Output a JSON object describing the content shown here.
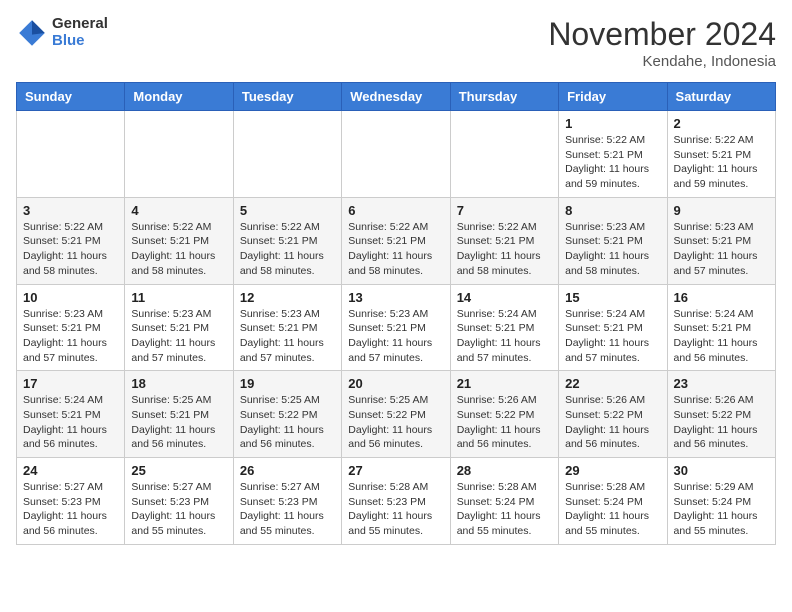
{
  "logo": {
    "general": "General",
    "blue": "Blue"
  },
  "header": {
    "month": "November 2024",
    "location": "Kendahe, Indonesia"
  },
  "weekdays": [
    "Sunday",
    "Monday",
    "Tuesday",
    "Wednesday",
    "Thursday",
    "Friday",
    "Saturday"
  ],
  "weeks": [
    [
      {
        "day": "",
        "sunrise": "",
        "sunset": "",
        "daylight": ""
      },
      {
        "day": "",
        "sunrise": "",
        "sunset": "",
        "daylight": ""
      },
      {
        "day": "",
        "sunrise": "",
        "sunset": "",
        "daylight": ""
      },
      {
        "day": "",
        "sunrise": "",
        "sunset": "",
        "daylight": ""
      },
      {
        "day": "",
        "sunrise": "",
        "sunset": "",
        "daylight": ""
      },
      {
        "day": "1",
        "sunrise": "Sunrise: 5:22 AM",
        "sunset": "Sunset: 5:21 PM",
        "daylight": "Daylight: 11 hours and 59 minutes."
      },
      {
        "day": "2",
        "sunrise": "Sunrise: 5:22 AM",
        "sunset": "Sunset: 5:21 PM",
        "daylight": "Daylight: 11 hours and 59 minutes."
      }
    ],
    [
      {
        "day": "3",
        "sunrise": "Sunrise: 5:22 AM",
        "sunset": "Sunset: 5:21 PM",
        "daylight": "Daylight: 11 hours and 58 minutes."
      },
      {
        "day": "4",
        "sunrise": "Sunrise: 5:22 AM",
        "sunset": "Sunset: 5:21 PM",
        "daylight": "Daylight: 11 hours and 58 minutes."
      },
      {
        "day": "5",
        "sunrise": "Sunrise: 5:22 AM",
        "sunset": "Sunset: 5:21 PM",
        "daylight": "Daylight: 11 hours and 58 minutes."
      },
      {
        "day": "6",
        "sunrise": "Sunrise: 5:22 AM",
        "sunset": "Sunset: 5:21 PM",
        "daylight": "Daylight: 11 hours and 58 minutes."
      },
      {
        "day": "7",
        "sunrise": "Sunrise: 5:22 AM",
        "sunset": "Sunset: 5:21 PM",
        "daylight": "Daylight: 11 hours and 58 minutes."
      },
      {
        "day": "8",
        "sunrise": "Sunrise: 5:23 AM",
        "sunset": "Sunset: 5:21 PM",
        "daylight": "Daylight: 11 hours and 58 minutes."
      },
      {
        "day": "9",
        "sunrise": "Sunrise: 5:23 AM",
        "sunset": "Sunset: 5:21 PM",
        "daylight": "Daylight: 11 hours and 57 minutes."
      }
    ],
    [
      {
        "day": "10",
        "sunrise": "Sunrise: 5:23 AM",
        "sunset": "Sunset: 5:21 PM",
        "daylight": "Daylight: 11 hours and 57 minutes."
      },
      {
        "day": "11",
        "sunrise": "Sunrise: 5:23 AM",
        "sunset": "Sunset: 5:21 PM",
        "daylight": "Daylight: 11 hours and 57 minutes."
      },
      {
        "day": "12",
        "sunrise": "Sunrise: 5:23 AM",
        "sunset": "Sunset: 5:21 PM",
        "daylight": "Daylight: 11 hours and 57 minutes."
      },
      {
        "day": "13",
        "sunrise": "Sunrise: 5:23 AM",
        "sunset": "Sunset: 5:21 PM",
        "daylight": "Daylight: 11 hours and 57 minutes."
      },
      {
        "day": "14",
        "sunrise": "Sunrise: 5:24 AM",
        "sunset": "Sunset: 5:21 PM",
        "daylight": "Daylight: 11 hours and 57 minutes."
      },
      {
        "day": "15",
        "sunrise": "Sunrise: 5:24 AM",
        "sunset": "Sunset: 5:21 PM",
        "daylight": "Daylight: 11 hours and 57 minutes."
      },
      {
        "day": "16",
        "sunrise": "Sunrise: 5:24 AM",
        "sunset": "Sunset: 5:21 PM",
        "daylight": "Daylight: 11 hours and 56 minutes."
      }
    ],
    [
      {
        "day": "17",
        "sunrise": "Sunrise: 5:24 AM",
        "sunset": "Sunset: 5:21 PM",
        "daylight": "Daylight: 11 hours and 56 minutes."
      },
      {
        "day": "18",
        "sunrise": "Sunrise: 5:25 AM",
        "sunset": "Sunset: 5:21 PM",
        "daylight": "Daylight: 11 hours and 56 minutes."
      },
      {
        "day": "19",
        "sunrise": "Sunrise: 5:25 AM",
        "sunset": "Sunset: 5:22 PM",
        "daylight": "Daylight: 11 hours and 56 minutes."
      },
      {
        "day": "20",
        "sunrise": "Sunrise: 5:25 AM",
        "sunset": "Sunset: 5:22 PM",
        "daylight": "Daylight: 11 hours and 56 minutes."
      },
      {
        "day": "21",
        "sunrise": "Sunrise: 5:26 AM",
        "sunset": "Sunset: 5:22 PM",
        "daylight": "Daylight: 11 hours and 56 minutes."
      },
      {
        "day": "22",
        "sunrise": "Sunrise: 5:26 AM",
        "sunset": "Sunset: 5:22 PM",
        "daylight": "Daylight: 11 hours and 56 minutes."
      },
      {
        "day": "23",
        "sunrise": "Sunrise: 5:26 AM",
        "sunset": "Sunset: 5:22 PM",
        "daylight": "Daylight: 11 hours and 56 minutes."
      }
    ],
    [
      {
        "day": "24",
        "sunrise": "Sunrise: 5:27 AM",
        "sunset": "Sunset: 5:23 PM",
        "daylight": "Daylight: 11 hours and 56 minutes."
      },
      {
        "day": "25",
        "sunrise": "Sunrise: 5:27 AM",
        "sunset": "Sunset: 5:23 PM",
        "daylight": "Daylight: 11 hours and 55 minutes."
      },
      {
        "day": "26",
        "sunrise": "Sunrise: 5:27 AM",
        "sunset": "Sunset: 5:23 PM",
        "daylight": "Daylight: 11 hours and 55 minutes."
      },
      {
        "day": "27",
        "sunrise": "Sunrise: 5:28 AM",
        "sunset": "Sunset: 5:23 PM",
        "daylight": "Daylight: 11 hours and 55 minutes."
      },
      {
        "day": "28",
        "sunrise": "Sunrise: 5:28 AM",
        "sunset": "Sunset: 5:24 PM",
        "daylight": "Daylight: 11 hours and 55 minutes."
      },
      {
        "day": "29",
        "sunrise": "Sunrise: 5:28 AM",
        "sunset": "Sunset: 5:24 PM",
        "daylight": "Daylight: 11 hours and 55 minutes."
      },
      {
        "day": "30",
        "sunrise": "Sunrise: 5:29 AM",
        "sunset": "Sunset: 5:24 PM",
        "daylight": "Daylight: 11 hours and 55 minutes."
      }
    ]
  ]
}
